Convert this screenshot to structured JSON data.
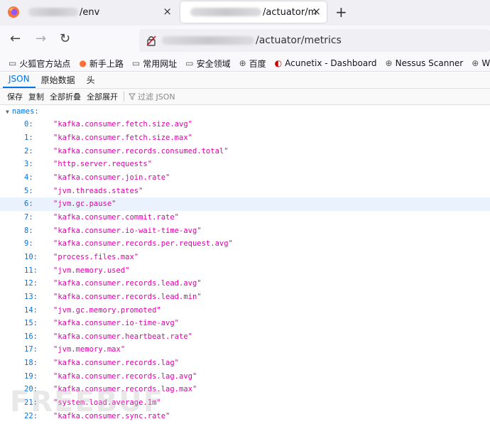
{
  "browser": {
    "tabs": [
      {
        "title": "/env",
        "close_glyph": "×"
      },
      {
        "title": "/actuator/m",
        "close_glyph": "×"
      }
    ],
    "new_tab_glyph": "+",
    "url": "/actuator/metrics",
    "bookmarks": [
      {
        "label": "火狐官方站点",
        "icon": "folder-icon"
      },
      {
        "label": "新手上路",
        "icon": "firefox-icon"
      },
      {
        "label": "常用网址",
        "icon": "folder-icon"
      },
      {
        "label": "安全领域",
        "icon": "folder-icon"
      },
      {
        "label": "百度",
        "icon": "globe-icon"
      },
      {
        "label": "Acunetix - Dashboard",
        "icon": "acunetix-icon"
      },
      {
        "label": "Nessus Scanner",
        "icon": "globe-icon"
      },
      {
        "label": "Woo",
        "icon": "globe-icon"
      }
    ]
  },
  "viewer": {
    "tabs": [
      "JSON",
      "原始数据",
      "头"
    ],
    "active_tab": "JSON",
    "toolbar": {
      "save": "保存",
      "copy": "复制",
      "collapse_all": "全部折叠",
      "expand_all": "全部展开",
      "filter_placeholder": "过滤 JSON"
    }
  },
  "json": {
    "key": "names:",
    "selected_index": 6,
    "items": [
      {
        "index": "0:",
        "value": "\"kafka.consumer.fetch.size.avg\""
      },
      {
        "index": "1:",
        "value": "\"kafka.consumer.fetch.size.max\""
      },
      {
        "index": "2:",
        "value": "\"kafka.consumer.records.consumed.total\""
      },
      {
        "index": "3:",
        "value": "\"http.server.requests\""
      },
      {
        "index": "4:",
        "value": "\"kafka.consumer.join.rate\""
      },
      {
        "index": "5:",
        "value": "\"jvm.threads.states\""
      },
      {
        "index": "6:",
        "value": "\"jvm.gc.pause\""
      },
      {
        "index": "7:",
        "value": "\"kafka.consumer.commit.rate\""
      },
      {
        "index": "8:",
        "value": "\"kafka.consumer.io-wait-time-avg\""
      },
      {
        "index": "9:",
        "value": "\"kafka.consumer.records.per.request.avg\""
      },
      {
        "index": "10:",
        "value": "\"process.files.max\""
      },
      {
        "index": "11:",
        "value": "\"jvm.memory.used\""
      },
      {
        "index": "12:",
        "value": "\"kafka.consumer.records.lead.avg\""
      },
      {
        "index": "13:",
        "value": "\"kafka.consumer.records.lead.min\""
      },
      {
        "index": "14:",
        "value": "\"jvm.gc.memory.promoted\""
      },
      {
        "index": "15:",
        "value": "\"kafka.consumer.io-time-avg\""
      },
      {
        "index": "16:",
        "value": "\"kafka.consumer.heartbeat.rate\""
      },
      {
        "index": "17:",
        "value": "\"jvm.memory.max\""
      },
      {
        "index": "18:",
        "value": "\"kafka.consumer.records.lag\""
      },
      {
        "index": "19:",
        "value": "\"kafka.consumer.records.lag.avg\""
      },
      {
        "index": "20:",
        "value": "\"kafka.consumer.records.lag.max\""
      },
      {
        "index": "21:",
        "value": "\"system.load.average.1m\""
      },
      {
        "index": "22:",
        "value": "\"kafka.consumer.sync.rate\""
      }
    ]
  },
  "watermark": "FREEBUF",
  "colors": {
    "accent": "#0074e8",
    "string": "#dd00a9",
    "selected_row": "#eaf3fd"
  }
}
